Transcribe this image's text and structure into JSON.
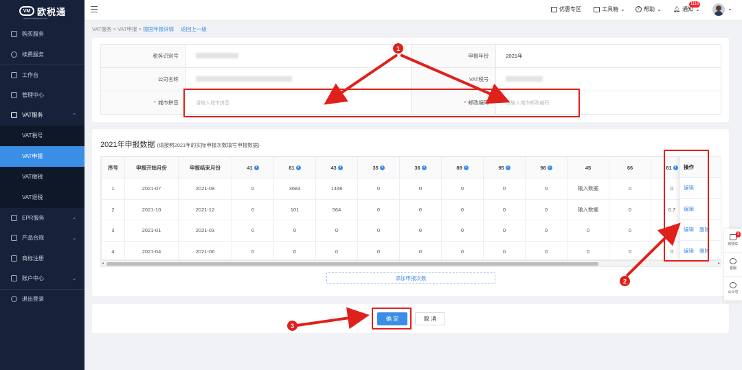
{
  "brand": {
    "name": "欧税通",
    "mark": "VM",
    "sub": "www.ezetaxvat.com"
  },
  "sidebar": {
    "items": [
      {
        "label": "购买服务"
      },
      {
        "label": "续费服务"
      },
      {
        "label": "工作台"
      },
      {
        "label": "管理中心"
      },
      {
        "label": "VAT服务"
      },
      {
        "label": "EPR服务"
      },
      {
        "label": "产品合规"
      },
      {
        "label": "商标注册"
      },
      {
        "label": "账户中心"
      },
      {
        "label": "退出登录"
      }
    ],
    "sub": [
      {
        "label": "VAT税号"
      },
      {
        "label": "VAT申报"
      },
      {
        "label": "VAT缴税"
      },
      {
        "label": "VAT退税"
      }
    ]
  },
  "header": {
    "coupon": "优惠专区",
    "tools": "工具箱",
    "help": "帮助",
    "notice": "通知",
    "notice_count": "1116"
  },
  "breadcrumb": {
    "a": "VAT服务",
    "b": "VAT申报",
    "c": "德国年报详情",
    "back": "返回上一级",
    "sep": ">"
  },
  "form": {
    "tax_id_label": "税务识别号",
    "year_label": "申报年份",
    "year_value": "2021年",
    "company_label": "公司名称",
    "vat_label": "VAT税号",
    "city_label": "城市拼音",
    "city_placeholder": "请输入城市拼音",
    "zip_label": "邮政编码",
    "zip_placeholder": "请输入城市邮政编码",
    "req": "*"
  },
  "section": {
    "title": "2021年申报数据",
    "note": "(请按照2021年的实际申报次数填写申报数据)"
  },
  "table": {
    "headers": [
      "序号",
      "申报开始月份",
      "申报结束月份",
      "41",
      "81",
      "43",
      "35",
      "36",
      "89",
      "95",
      "98",
      "45",
      "66",
      "61"
    ],
    "op_header": "操作",
    "edit": "编辑",
    "delete": "删除",
    "placeholder": "输入数据",
    "rows": [
      [
        "1",
        "2021-07",
        "2021-09",
        "0",
        "3683",
        "1448",
        "0",
        "0",
        "0",
        "0",
        "0",
        "",
        "0",
        "0"
      ],
      [
        "2",
        "2021-10",
        "2021-12",
        "0",
        "101",
        "564",
        "0",
        "0",
        "0",
        "0",
        "0",
        "",
        "0",
        "0.7"
      ],
      [
        "3",
        "2021-01",
        "2021-03",
        "0",
        "0",
        "0",
        "0",
        "0",
        "0",
        "0",
        "0",
        "0",
        "0",
        "0"
      ],
      [
        "4",
        "2021-04",
        "2021-06",
        "0",
        "0",
        "0",
        "0",
        "0",
        "0",
        "0",
        "0",
        "0",
        "0",
        "0"
      ]
    ]
  },
  "add_button": "添加申报次数",
  "actions": {
    "ok": "确 定",
    "cancel": "取 消"
  },
  "annotations": [
    "1",
    "2",
    "3"
  ],
  "right_tools": {
    "cart": "购物车",
    "cart_count": "3",
    "service": "客服",
    "wechat": "公众号"
  },
  "colors": {
    "primary": "#3a8ee6",
    "sidebar": "#16223a",
    "annotation": "#e0201a"
  }
}
